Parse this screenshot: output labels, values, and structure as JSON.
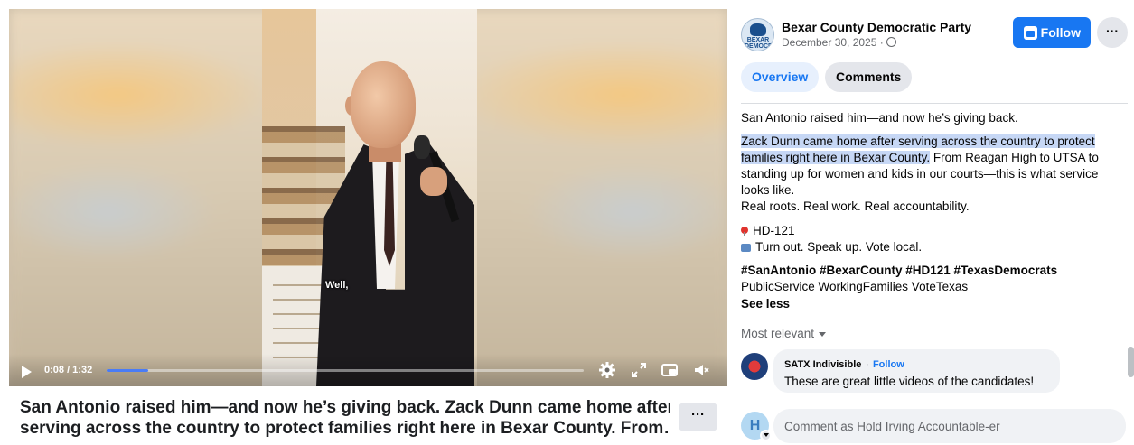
{
  "video": {
    "caption_text": "Well,",
    "time_display": "0:08 / 1:32",
    "progress_fraction": 0.087,
    "controls": {
      "play": "play-icon",
      "settings": "gear-icon",
      "expand": "expand-icon",
      "miniplayer": "miniplayer-icon",
      "mute": "mute-icon"
    }
  },
  "post_title": {
    "line1": "San Antonio raised him—and now he’s giving back. Zack Dunn came home after",
    "line2": "serving across the country to protect families right here in Bexar County. From…",
    "more_label": "···"
  },
  "header": {
    "page_name": "Bexar County Democratic Party",
    "date": "December 30, 2025 ·",
    "avatar_text": "BEXAR DEMOCRATS",
    "follow_label": "Follow",
    "more_label": "···"
  },
  "tabs": [
    {
      "label": "Overview",
      "active": true
    },
    {
      "label": "Comments",
      "active": false
    }
  ],
  "post_body": {
    "intro": "San Antonio raised him—and now he’s giving back.",
    "highlighted": "Zack Dunn came home after serving across the country to protect families right here in Bexar County.",
    "continued": " From Reagan High to UTSA to standing up for women and kids in our courts—this is what service looks like.",
    "tagline": "Real roots. Real work. Real accountability.",
    "district": "HD-121",
    "call_to_action": "Turn out. Speak up. Vote local.",
    "hashtags": "#SanAntonio #BexarCounty #HD121 #TexasDemocrats",
    "plain_tags": "PublicService WorkingFamilies VoteTexas",
    "see_less": "See less"
  },
  "comments": {
    "sort_label": "Most relevant",
    "items": [
      {
        "author": "SATX Indivisible",
        "follow_label": "Follow",
        "separator": "·",
        "text": "These are great little videos of the candidates!"
      }
    ],
    "composer": {
      "avatar_letter": "H",
      "placeholder": "Comment as Hold Irving Accountable-er"
    }
  },
  "colors": {
    "accent": "#1877f2",
    "highlight": "#c6d7f5",
    "progress": "#4a7cf6"
  }
}
